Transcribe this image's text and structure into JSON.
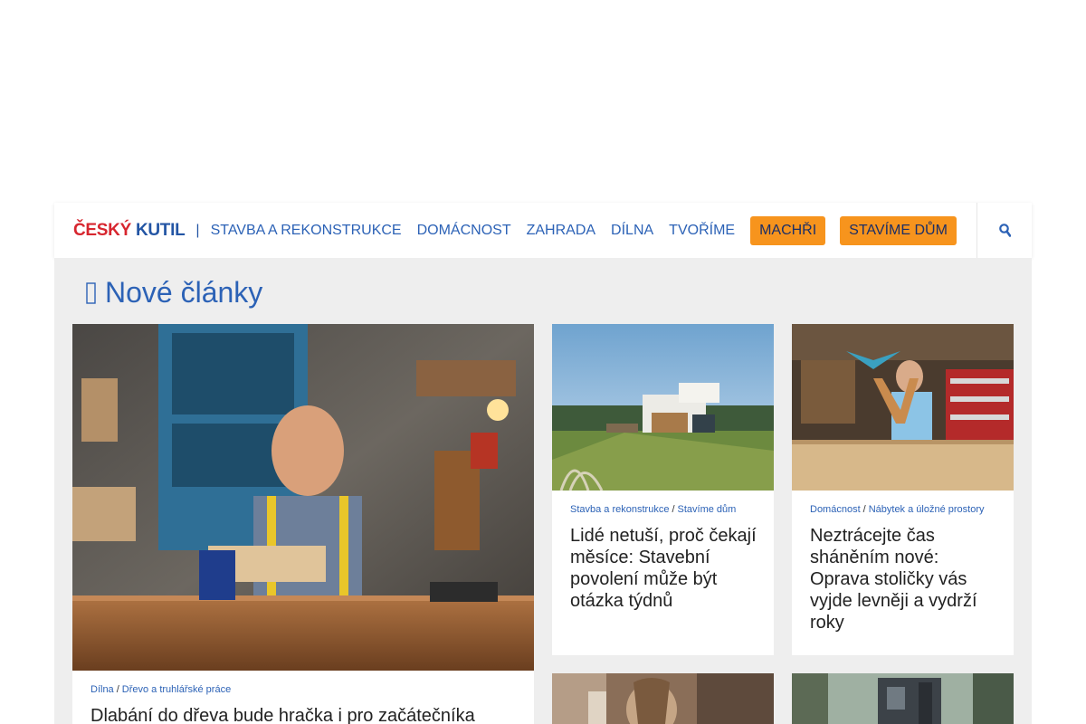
{
  "nav": {
    "logo_part1": "ČESKÝ",
    "logo_part2": "KUTIL",
    "separator": "|",
    "links": [
      "STAVBA A REKONSTRUKCE",
      "DOMÁCNOST",
      "ZAHRADA",
      "DÍLNA",
      "TVOŘÍME"
    ],
    "buttons": [
      "MACHŘI",
      "STAVÍME DŮM"
    ],
    "search_icon": "search-icon"
  },
  "section": {
    "icon": "clock-icon",
    "title": "Nové články"
  },
  "articles": [
    {
      "category": "Dílna",
      "subcategory": "Dřevo a truhlářské práce",
      "title": "Dlabání do dřeva bude hračka i pro začátečníka",
      "image": "workshop-man-photo"
    },
    {
      "category": "Stavba a rekonstrukce",
      "subcategory": "Stavíme dům",
      "title": "Lidé netuší, proč čekají měsíce: Stavební povolení může být otázka týdnů",
      "image": "modern-house-photo"
    },
    {
      "category": "Domácnost",
      "subcategory": "Nábytek a úložné prostory",
      "title": "Neztrácejte čas sháněním nové: Oprava stoličky vás vyjde levněji a vydrží roky",
      "image": "woman-workshop-chair-photo"
    },
    {
      "image": "woman-braid-photo"
    },
    {
      "image": "forest-machine-photo"
    }
  ],
  "colors": {
    "brand_red": "#d7262f",
    "brand_blue": "#2355a4",
    "link_blue": "#2c62b6",
    "button_orange": "#f7941d",
    "panel_gray": "#eeeeee"
  }
}
